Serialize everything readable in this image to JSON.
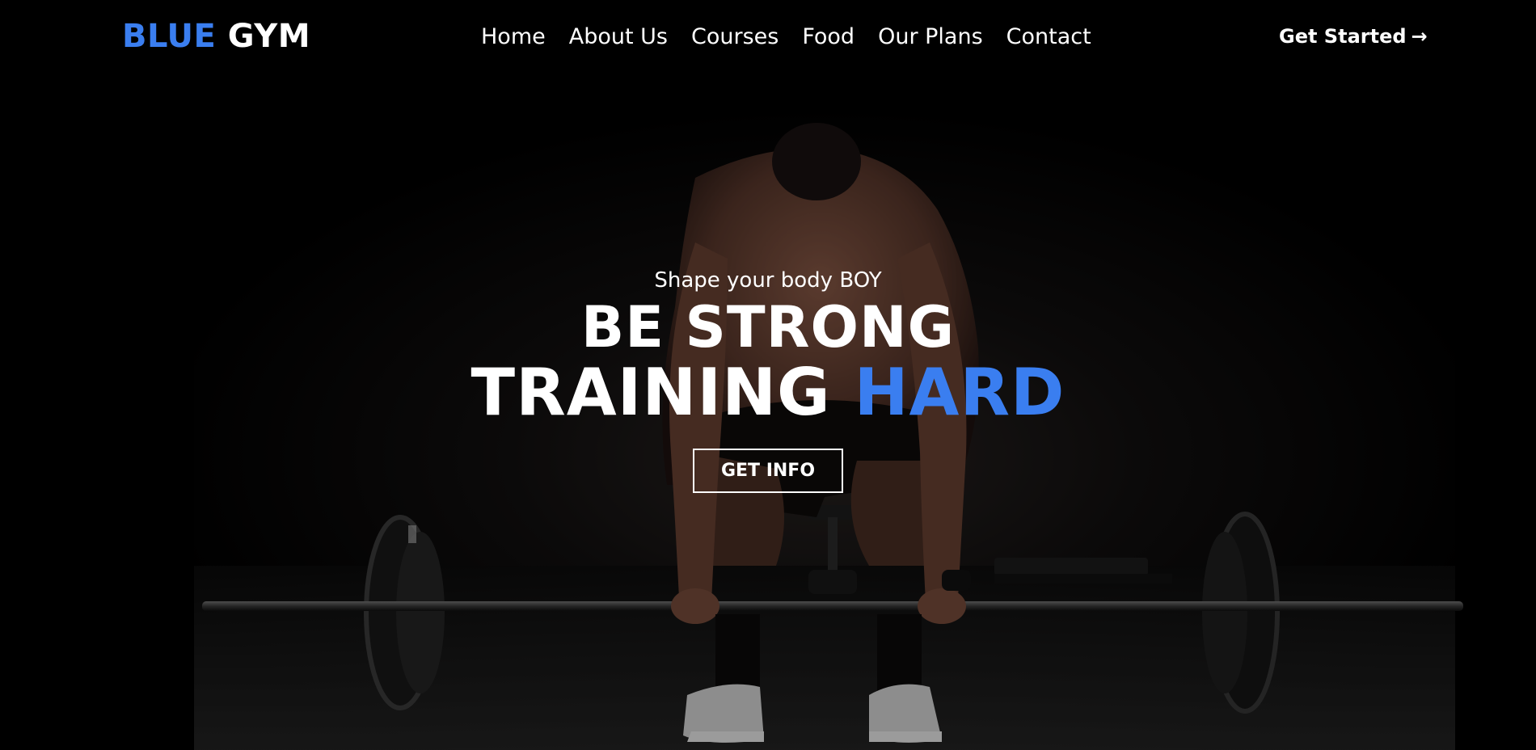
{
  "brand": {
    "name_part1": "BLUE",
    "name_part2": "GYM",
    "accent_color": "#3a7ef0"
  },
  "nav": {
    "items": [
      {
        "label": "Home"
      },
      {
        "label": "About Us"
      },
      {
        "label": "Courses"
      },
      {
        "label": "Food"
      },
      {
        "label": "Our Plans"
      },
      {
        "label": "Contact"
      }
    ],
    "cta_label": "Get Started",
    "cta_icon": "arrow-right-icon"
  },
  "hero": {
    "tagline": "Shape your body BOY",
    "title_line1": "BE STRONG",
    "title_line2_main": "TRAINING",
    "title_line2_accent": "HARD",
    "button_label": "GET INFO",
    "background_image": "athlete-deadlift-photo"
  }
}
